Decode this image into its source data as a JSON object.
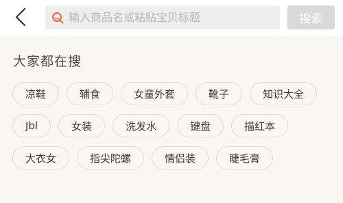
{
  "search": {
    "placeholder": "输入商品名或粘贴宝贝标题",
    "button_label": "搜索"
  },
  "popular": {
    "title": "大家都在搜",
    "rows": [
      [
        "凉鞋",
        "辅食",
        "女童外套",
        "靴子",
        "知识大全"
      ],
      [
        "Jbl",
        "女装",
        "洗发水",
        "键盘",
        "描红本"
      ],
      [
        "大衣女",
        "指尖陀螺",
        "情侣装",
        "睫毛膏"
      ]
    ]
  },
  "colors": {
    "background": "#f8f7f4",
    "search_icon": "#f1673e",
    "button": "#d9d9d9"
  }
}
